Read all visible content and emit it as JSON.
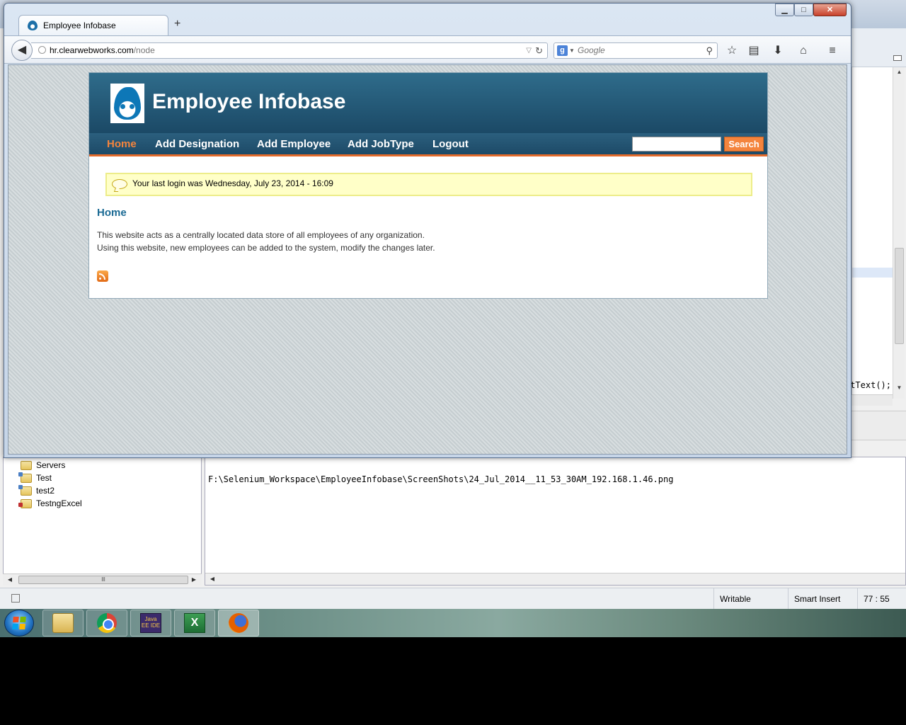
{
  "browser": {
    "tab_title": "Employee Infobase",
    "new_tab": "+",
    "url_host": "hr.clearwebworks.com",
    "url_path": "/node",
    "search_placeholder": "Google",
    "window_controls": {
      "minimize": "▁",
      "maximize": "□",
      "close": "✕"
    }
  },
  "site": {
    "name": "Employee Infobase",
    "menu": [
      {
        "label": "Home"
      },
      {
        "label": "Add Designation"
      },
      {
        "label": "Add Employee"
      },
      {
        "label": "Add JobType"
      },
      {
        "label": "Logout"
      }
    ],
    "search_button": "Search",
    "message": "Your last login was Wednesday, July 23, 2014 - 16:09",
    "page_title": "Home",
    "body_lines": [
      "This website acts as a centrally located data store of all employees of any organization.",
      "Using this website, new employees can be added to the system, modify the changes later."
    ]
  },
  "ide": {
    "code_fragment": "tText();",
    "projects": [
      {
        "name": "Servers",
        "icon": "folder-icon"
      },
      {
        "name": "Test",
        "icon": "project-icon"
      },
      {
        "name": "test2",
        "icon": "project-icon"
      },
      {
        "name": "TestngExcel",
        "icon": "excel-project-icon"
      }
    ],
    "console_line": "F:\\Selenium_Workspace\\EmployeeInfobase\\ScreenShots\\24_Jul_2014__11_53_30AM_192.168.1.46.png",
    "status": {
      "writable": "Writable",
      "insert_mode": "Smart Insert",
      "position": "77 : 55"
    }
  },
  "taskbar": {
    "apps": [
      {
        "name": "Windows Explorer",
        "icon": "explorer-icon"
      },
      {
        "name": "Google Chrome",
        "icon": "chrome-icon"
      },
      {
        "name": "Eclipse Java EE IDE",
        "icon": "eclipse-icon",
        "label": "Java EE IDE"
      },
      {
        "name": "Microsoft Excel",
        "icon": "excel-icon",
        "label": "X"
      },
      {
        "name": "Firefox",
        "icon": "firefox-icon"
      }
    ]
  }
}
